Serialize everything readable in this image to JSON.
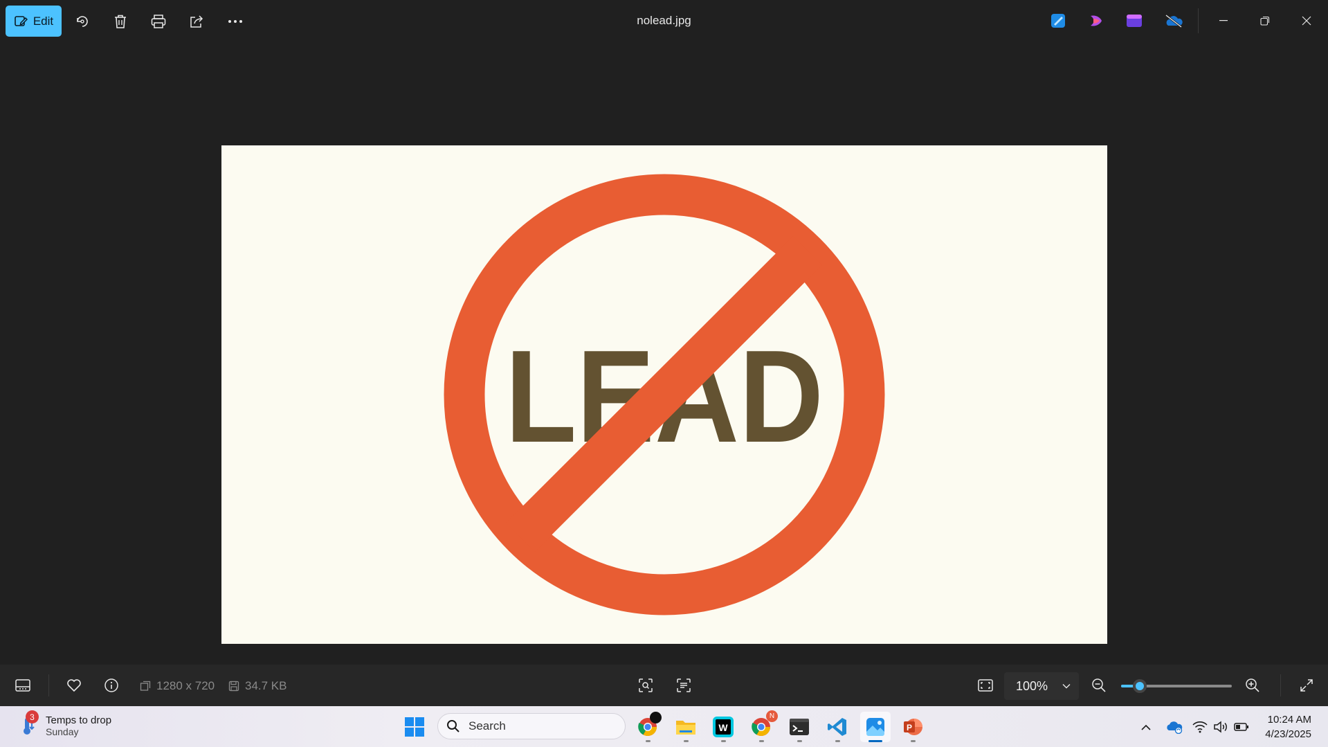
{
  "titlebar": {
    "edit_label": "Edit",
    "file_name": "nolead.jpg",
    "left_icons": [
      "rotate-icon",
      "delete-icon",
      "print-icon",
      "share-icon",
      "more-icon"
    ],
    "right_apps": [
      "photos-editor-icon",
      "clipchamp-icon",
      "designer-icon",
      "onedrive-off-icon"
    ],
    "window_controls": [
      "minimize-icon",
      "restore-icon",
      "close-icon"
    ]
  },
  "photo": {
    "text": "LEAD",
    "colors": {
      "background": "#fcfbf1",
      "sign": "#e85d33",
      "text": "#635231"
    }
  },
  "bottombar": {
    "dimensions": "1280 x 720",
    "file_size": "34.7 KB",
    "zoom_value": "100%",
    "zoom_level": 0.17
  },
  "taskbar": {
    "weather_title": "Temps to drop",
    "weather_sub": "Sunday",
    "weather_badge": "3",
    "search_placeholder": "Search",
    "chrome_badge": "N",
    "time": "10:24 AM",
    "date": "4/23/2025",
    "apps": [
      "windows-start-icon",
      "chrome-icon",
      "file-explorer-icon",
      "webstorm-icon",
      "chrome-profile-icon",
      "terminal-icon",
      "vscode-icon",
      "photos-icon",
      "powerpoint-icon"
    ]
  },
  "colors": {
    "accent": "#4cc2ff",
    "app_bg": "#202020",
    "bottom_bg": "#272727"
  }
}
